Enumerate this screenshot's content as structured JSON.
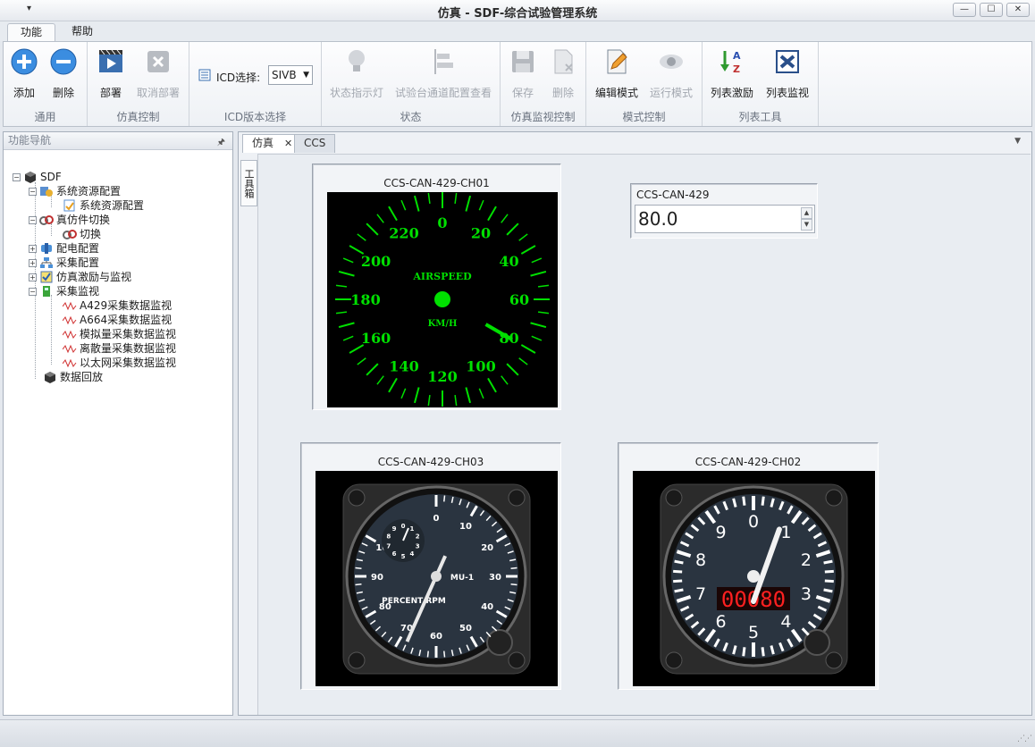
{
  "window": {
    "title": "仿真 - SDF-综合试验管理系统",
    "quick_access": "▾",
    "min": "—",
    "max": "☐",
    "close": "✕"
  },
  "ribbon_tabs": [
    "功能",
    "帮助"
  ],
  "ribbon": {
    "groups": {
      "common": "通用",
      "sim_control": "仿真控制",
      "icd": "ICD版本选择",
      "status": "状态",
      "sim_monitor": "仿真监视控制",
      "mode": "模式控制",
      "list_tools": "列表工具"
    },
    "buttons": {
      "add": "添加",
      "delete": "删除",
      "deploy": "部署",
      "undeploy": "取消部署",
      "status_light": "状态指示灯",
      "channel_view": "试验台通道配置查看",
      "save": "保存",
      "remove": "删除",
      "edit_mode": "编辑模式",
      "run_mode": "运行模式",
      "list_stimulus": "列表激励",
      "list_monitor": "列表监视"
    },
    "icd_label": "ICD选择:",
    "icd_value": "SIVB"
  },
  "nav": {
    "title": "功能导航",
    "pin": "🖈",
    "tree": {
      "root": "SDF",
      "sys_config": "系统资源配置",
      "sys_config_child": "系统资源配置",
      "switch": "真仿件切换",
      "switch_child": "切换",
      "power": "配电配置",
      "acquire": "采集配置",
      "stimulus": "仿真激励与监视",
      "monitor": "采集监视",
      "m_a429": "A429采集数据监视",
      "m_a664": "A664采集数据监视",
      "m_analog": "模拟量采集数据监视",
      "m_discrete": "离散量采集数据监视",
      "m_ethernet": "以太网采集数据监视",
      "replay": "数据回放"
    }
  },
  "doc": {
    "tabs": [
      {
        "label": "仿真",
        "close": "✕"
      },
      {
        "label": "CCS"
      }
    ],
    "side_tool": "工具箱",
    "widgets": {
      "airspeed": {
        "title": "CCS-CAN-429-CH01",
        "label_top": "AIRSPEED",
        "label_unit": "KM/H",
        "ticks": [
          "0",
          "20",
          "40",
          "60",
          "80",
          "100",
          "120",
          "140",
          "160",
          "180",
          "200",
          "220"
        ],
        "value": 80,
        "color": "#00e000"
      },
      "numeric": {
        "title": "CCS-CAN-429",
        "value": "80.0"
      },
      "rpm": {
        "title": "CCS-CAN-429-CH03",
        "ticks": [
          "0",
          "10",
          "20",
          "30",
          "40",
          "50",
          "60",
          "70",
          "80",
          "90",
          "100"
        ],
        "sub_ticks": [
          "0",
          "1",
          "2",
          "3",
          "4",
          "5",
          "6",
          "7",
          "8",
          "9"
        ],
        "label_unit": "PERCENT RPM",
        "label_id": "MU-1",
        "value": 8
      },
      "clock": {
        "title": "CCS-CAN-429-CH02",
        "ticks": [
          "0",
          "1",
          "2",
          "3",
          "4",
          "5",
          "6",
          "7",
          "8",
          "9"
        ],
        "counter": "00080",
        "value": 0.8
      }
    }
  }
}
